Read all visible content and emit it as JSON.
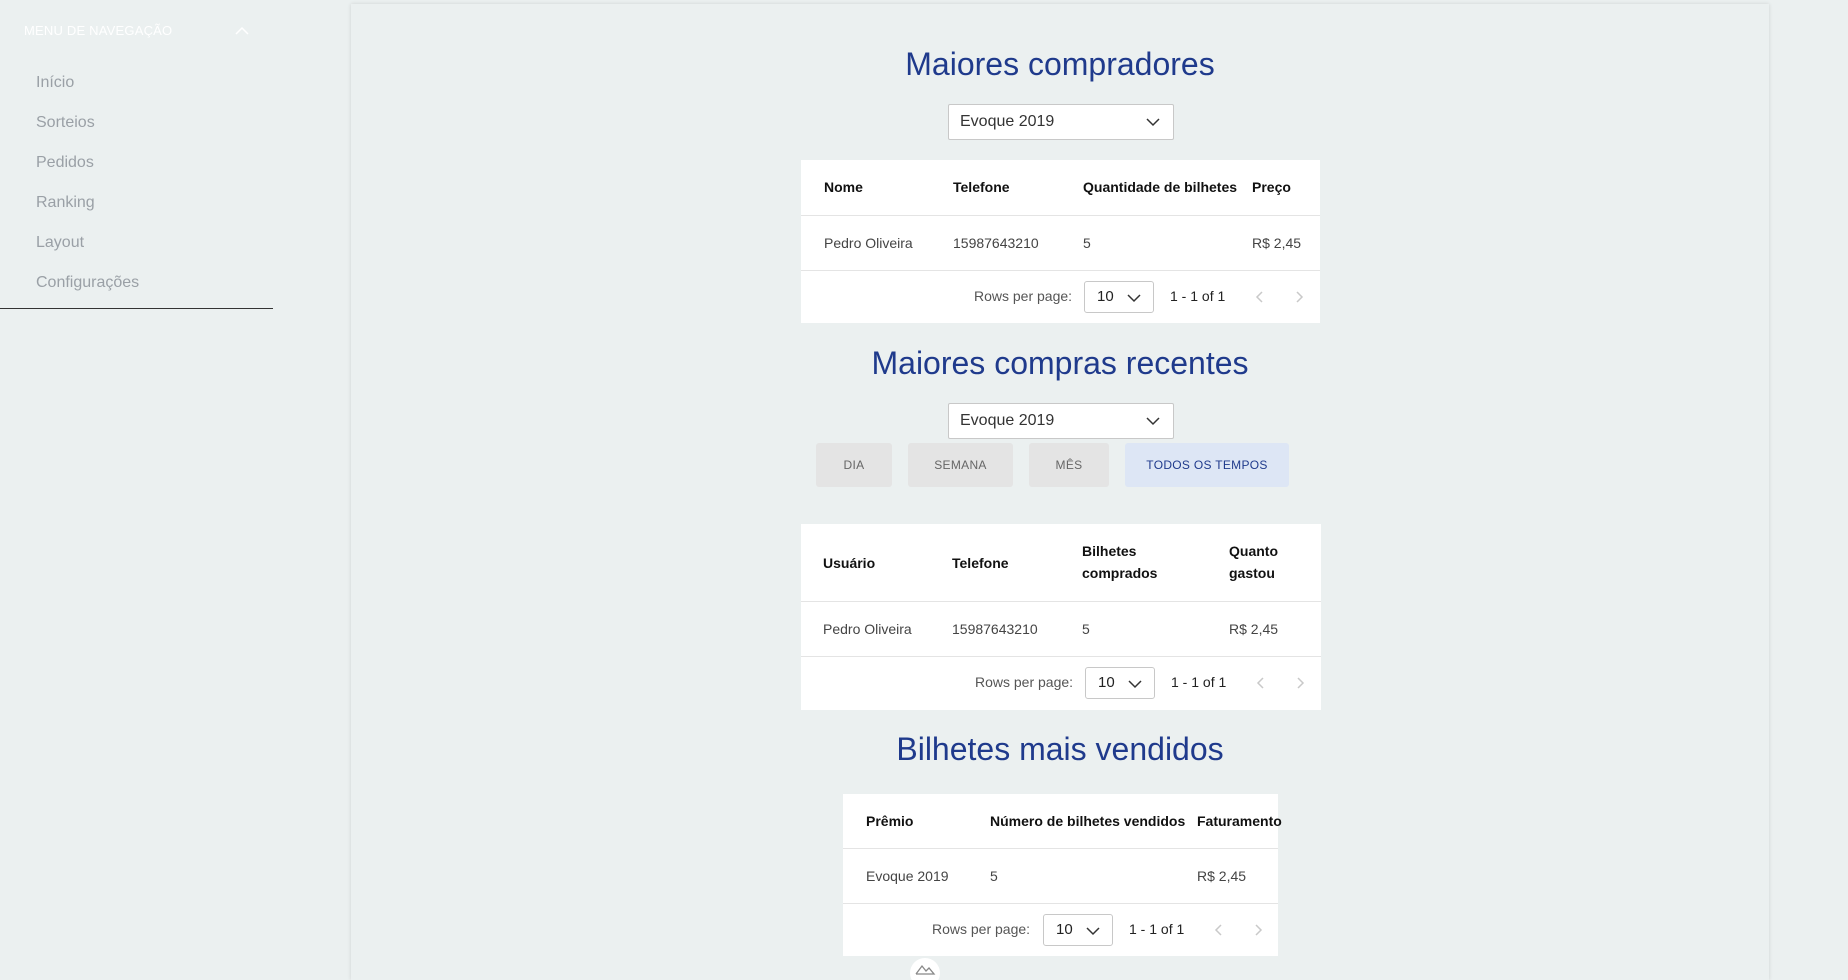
{
  "sidebar": {
    "menu_title": "MENU DE NAVEGAÇÃO",
    "items": [
      {
        "label": "Início"
      },
      {
        "label": "Sorteios"
      },
      {
        "label": "Pedidos"
      },
      {
        "label": "Ranking"
      },
      {
        "label": "Layout"
      },
      {
        "label": "Configurações"
      }
    ]
  },
  "buyers": {
    "title": "Maiores compradores",
    "selected": "Evoque 2019",
    "columns": [
      "Nome",
      "Telefone",
      "Quantidade de bilhetes",
      "Preço"
    ],
    "rows": [
      [
        "Pedro Oliveira",
        "15987643210",
        "5",
        "R$ 2,45"
      ]
    ],
    "rows_per_page_label": "Rows per page:",
    "rows_per_page": "10",
    "range": "1 - 1 of 1"
  },
  "recent": {
    "title": "Maiores compras recentes",
    "selected": "Evoque 2019",
    "periods": [
      "DIA",
      "SEMANA",
      "MÊS",
      "TODOS OS TEMPOS"
    ],
    "active_period": "TODOS OS TEMPOS",
    "columns": [
      "Usuário",
      "Telefone",
      "Bilhetes comprados",
      "Quanto gastou"
    ],
    "rows": [
      [
        "Pedro Oliveira",
        "15987643210",
        "5",
        "R$ 2,45"
      ]
    ],
    "rows_per_page_label": "Rows per page:",
    "rows_per_page": "10",
    "range": "1 - 1 of 1"
  },
  "tickets": {
    "title": "Bilhetes mais vendidos",
    "columns": [
      "Prêmio",
      "Número de bilhetes vendidos",
      "Faturamento"
    ],
    "rows": [
      [
        "Evoque 2019",
        "5",
        "R$ 2,45"
      ]
    ],
    "rows_per_page_label": "Rows per page:",
    "rows_per_page": "10",
    "range": "1 - 1 of 1"
  },
  "icons": {
    "menu_toggle": "chevron-up-icon",
    "select": "chevron-down-icon",
    "prev": "chevron-left-icon",
    "next": "chevron-right-icon",
    "bottom": "mountain-logo-icon"
  },
  "colors": {
    "title": "#1f3a8c",
    "active_period_bg": "#dde6f5",
    "page_bg": "#ebf0f0"
  }
}
